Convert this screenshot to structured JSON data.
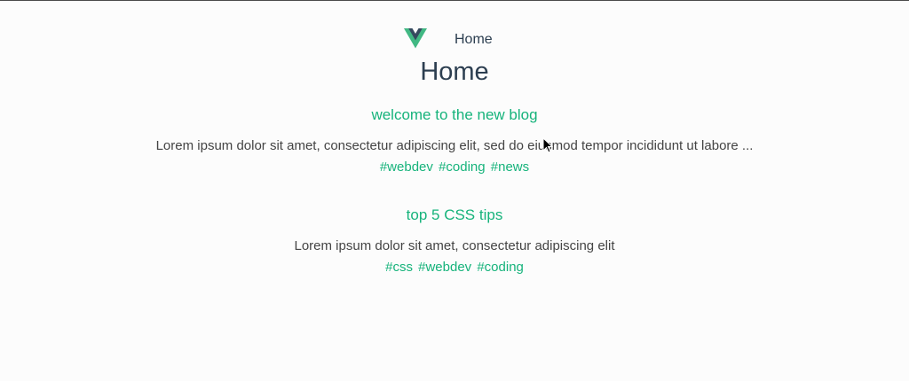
{
  "nav": {
    "home_label": "Home"
  },
  "page": {
    "title": "Home"
  },
  "posts": [
    {
      "title": "welcome to the new blog",
      "body": "Lorem ipsum dolor sit amet, consectetur adipiscing elit, sed do eiusmod tempor incididunt ut labore ...",
      "tags": [
        "#webdev",
        "#coding",
        "#news"
      ]
    },
    {
      "title": "top 5 CSS tips",
      "body": "Lorem ipsum dolor sit amet, consectetur adipiscing elit",
      "tags": [
        "#css",
        "#webdev",
        "#coding"
      ]
    }
  ],
  "colors": {
    "accent": "#16b37b",
    "text": "#2c3e50",
    "logo_dark": "#35495e",
    "logo_green": "#41b883"
  },
  "icons": {
    "logo": "vue-logo-icon",
    "cursor": "mouse-cursor-icon"
  }
}
